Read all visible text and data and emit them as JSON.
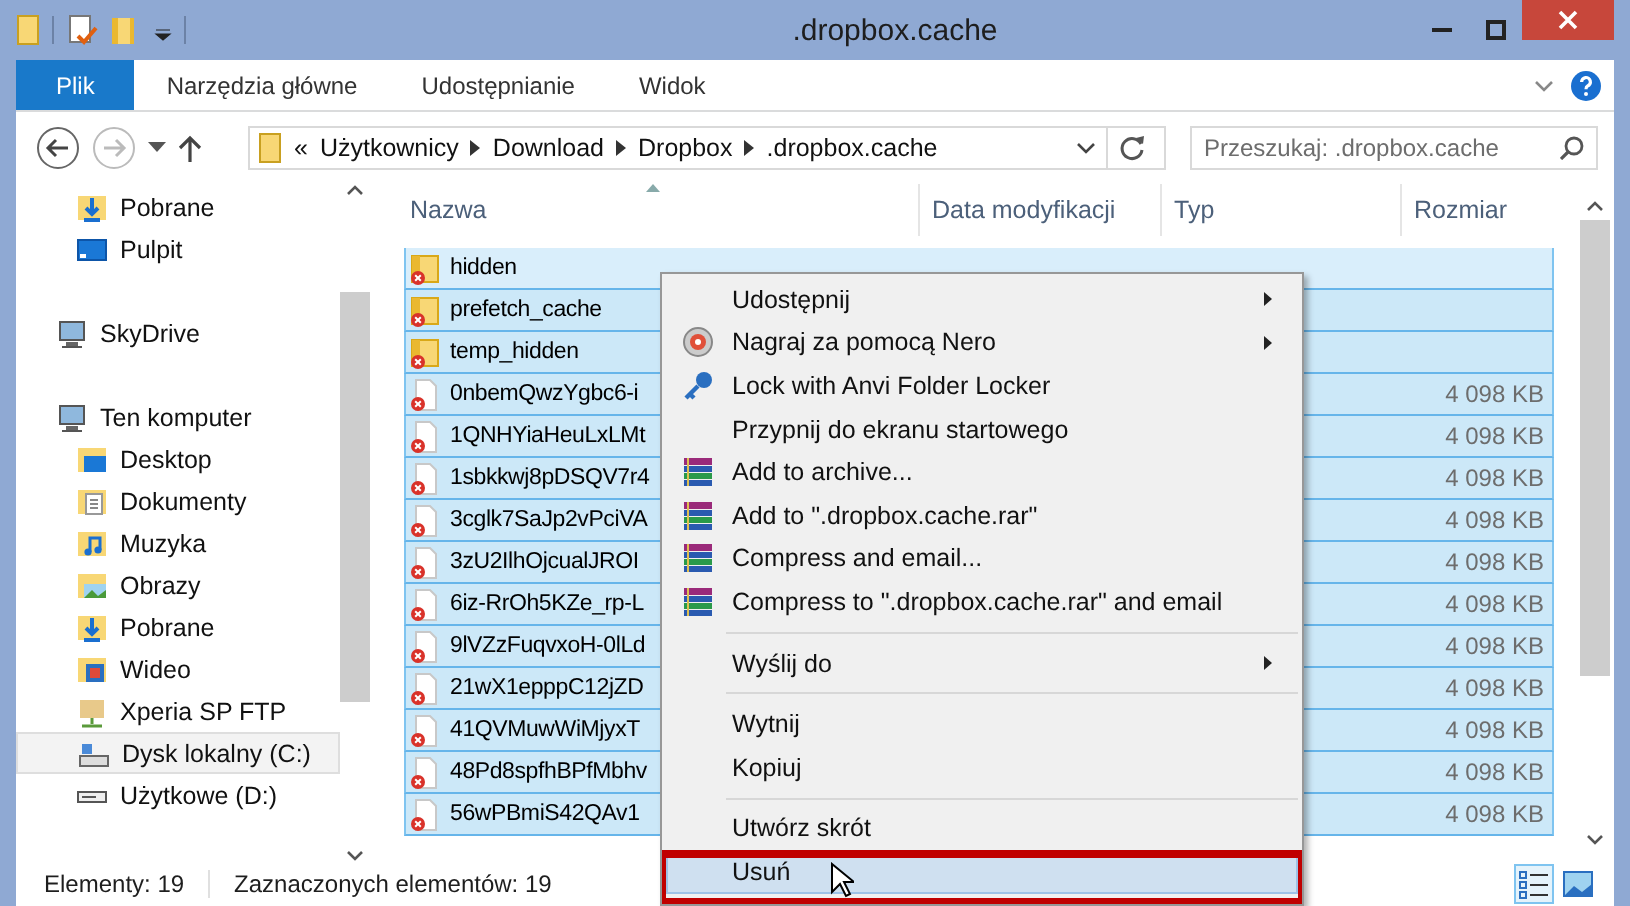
{
  "window": {
    "title": ".dropbox.cache"
  },
  "ribbon": {
    "tabs": [
      {
        "label": "Plik",
        "kind": "file",
        "selected": false
      },
      {
        "label": "Narzędzia główne",
        "kind": "tab",
        "selected": false
      },
      {
        "label": "Udostępnianie",
        "kind": "tab",
        "selected": false
      },
      {
        "label": "Widok",
        "kind": "tab",
        "selected": false
      }
    ]
  },
  "address_bar": {
    "overflow": "«",
    "breadcrumbs": [
      "Użytkownicy",
      "Download",
      "Dropbox",
      ".dropbox.cache"
    ]
  },
  "search": {
    "placeholder": "Przeszukaj: .dropbox.cache"
  },
  "sidebar": {
    "favorites": [
      {
        "label": "Pobrane",
        "kind": "download",
        "selected": false
      },
      {
        "label": "Pulpit",
        "kind": "desktop",
        "selected": false
      }
    ],
    "tree": [
      {
        "label": "SkyDrive",
        "kind": "computer",
        "selected": false
      },
      {
        "label": "Ten komputer",
        "kind": "computer",
        "selected": false,
        "children": [
          {
            "label": "Desktop",
            "kind": "desktop-folder",
            "selected": false
          },
          {
            "label": "Dokumenty",
            "kind": "documents",
            "selected": false
          },
          {
            "label": "Muzyka",
            "kind": "music",
            "selected": false
          },
          {
            "label": "Obrazy",
            "kind": "pictures",
            "selected": false
          },
          {
            "label": "Pobrane",
            "kind": "download",
            "selected": false
          },
          {
            "label": "Wideo",
            "kind": "video",
            "selected": false
          },
          {
            "label": "Xperia SP FTP",
            "kind": "ftp",
            "selected": false
          },
          {
            "label": "Dysk lokalny (C:)",
            "kind": "system-drive",
            "selected": true
          },
          {
            "label": "Użytkowe (D:)",
            "kind": "drive",
            "selected": false
          }
        ]
      }
    ]
  },
  "table": {
    "columns": [
      "Nazwa",
      "Data modyfikacji",
      "Typ",
      "Rozmiar"
    ],
    "rows": [
      {
        "name": "hidden",
        "kind": "folder",
        "selected": true,
        "hovered": true
      },
      {
        "name": "prefetch_cache",
        "kind": "folder",
        "selected": true,
        "hovered": false
      },
      {
        "name": "temp_hidden",
        "kind": "folder",
        "selected": true,
        "hovered": false
      },
      {
        "name": "0nbemQwzYgbc6-i",
        "kind": "file",
        "size": "4 098 KB",
        "selected": true,
        "hovered": false
      },
      {
        "name": "1QNHYiaHeuLxLMt",
        "kind": "file",
        "size": "4 098 KB",
        "selected": true,
        "hovered": false
      },
      {
        "name": "1sbkkwj8pDSQV7r4",
        "kind": "file",
        "size": "4 098 KB",
        "selected": true,
        "hovered": false
      },
      {
        "name": "3cglk7SaJp2vPciVA",
        "kind": "file",
        "size": "4 098 KB",
        "selected": true,
        "hovered": false
      },
      {
        "name": "3zU2IlhOjcualJROI",
        "kind": "file",
        "size": "4 098 KB",
        "selected": true,
        "hovered": false
      },
      {
        "name": "6iz-RrOh5KZe_rp-L",
        "kind": "file",
        "size": "4 098 KB",
        "selected": true,
        "hovered": false
      },
      {
        "name": "9lVZzFuqvxoH-0lLd",
        "kind": "file",
        "size": "4 098 KB",
        "selected": true,
        "hovered": false
      },
      {
        "name": "21wX1epppC12jZD",
        "kind": "file",
        "size": "4 098 KB",
        "selected": true,
        "hovered": false
      },
      {
        "name": "41QVMuwWiMjyxT",
        "kind": "file",
        "size": "4 098 KB",
        "selected": true,
        "hovered": false
      },
      {
        "name": "48Pd8spfhBPfMbhv",
        "kind": "file",
        "size": "4 098 KB",
        "selected": true,
        "hovered": false
      },
      {
        "name": "56wPBmiS42QAv1",
        "kind": "file",
        "size": "4 098 KB",
        "selected": true,
        "hovered": false
      }
    ]
  },
  "status_bar": {
    "items": "Elementy: 19",
    "selected": "Zaznaczonych elementów: 19",
    "views": [
      {
        "kind": "details",
        "selected": true
      },
      {
        "kind": "large-icons",
        "selected": false
      }
    ]
  },
  "context_menu": {
    "items": [
      {
        "kind": "item",
        "label": "Udostępnij",
        "submenu": true,
        "highlighted": false
      },
      {
        "kind": "item",
        "label": "Nagraj za pomocą Nero",
        "submenu": true,
        "highlighted": false
      },
      {
        "kind": "item",
        "label": "Lock with Anvi Folder Locker",
        "submenu": false,
        "highlighted": false
      },
      {
        "kind": "item",
        "label": "Przypnij do ekranu startowego",
        "submenu": false,
        "highlighted": false
      },
      {
        "kind": "item",
        "label": "Add to archive...",
        "submenu": false,
        "highlighted": false
      },
      {
        "kind": "item",
        "label": "Add to \".dropbox.cache.rar\"",
        "submenu": false,
        "highlighted": false
      },
      {
        "kind": "item",
        "label": "Compress and email...",
        "submenu": false,
        "highlighted": false
      },
      {
        "kind": "item",
        "label": "Compress to \".dropbox.cache.rar\" and email",
        "submenu": false,
        "highlighted": false
      },
      {
        "kind": "separator"
      },
      {
        "kind": "item",
        "label": "Wyślij do",
        "submenu": true,
        "highlighted": false
      },
      {
        "kind": "separator"
      },
      {
        "kind": "item",
        "label": "Wytnij",
        "submenu": false,
        "highlighted": false
      },
      {
        "kind": "item",
        "label": "Kopiuj",
        "submenu": false,
        "highlighted": false
      },
      {
        "kind": "separator"
      },
      {
        "kind": "item",
        "label": "Utwórz skrót",
        "submenu": false,
        "highlighted": false
      },
      {
        "kind": "item",
        "label": "Usuń",
        "submenu": false,
        "highlighted": true,
        "annotated": true
      }
    ]
  }
}
